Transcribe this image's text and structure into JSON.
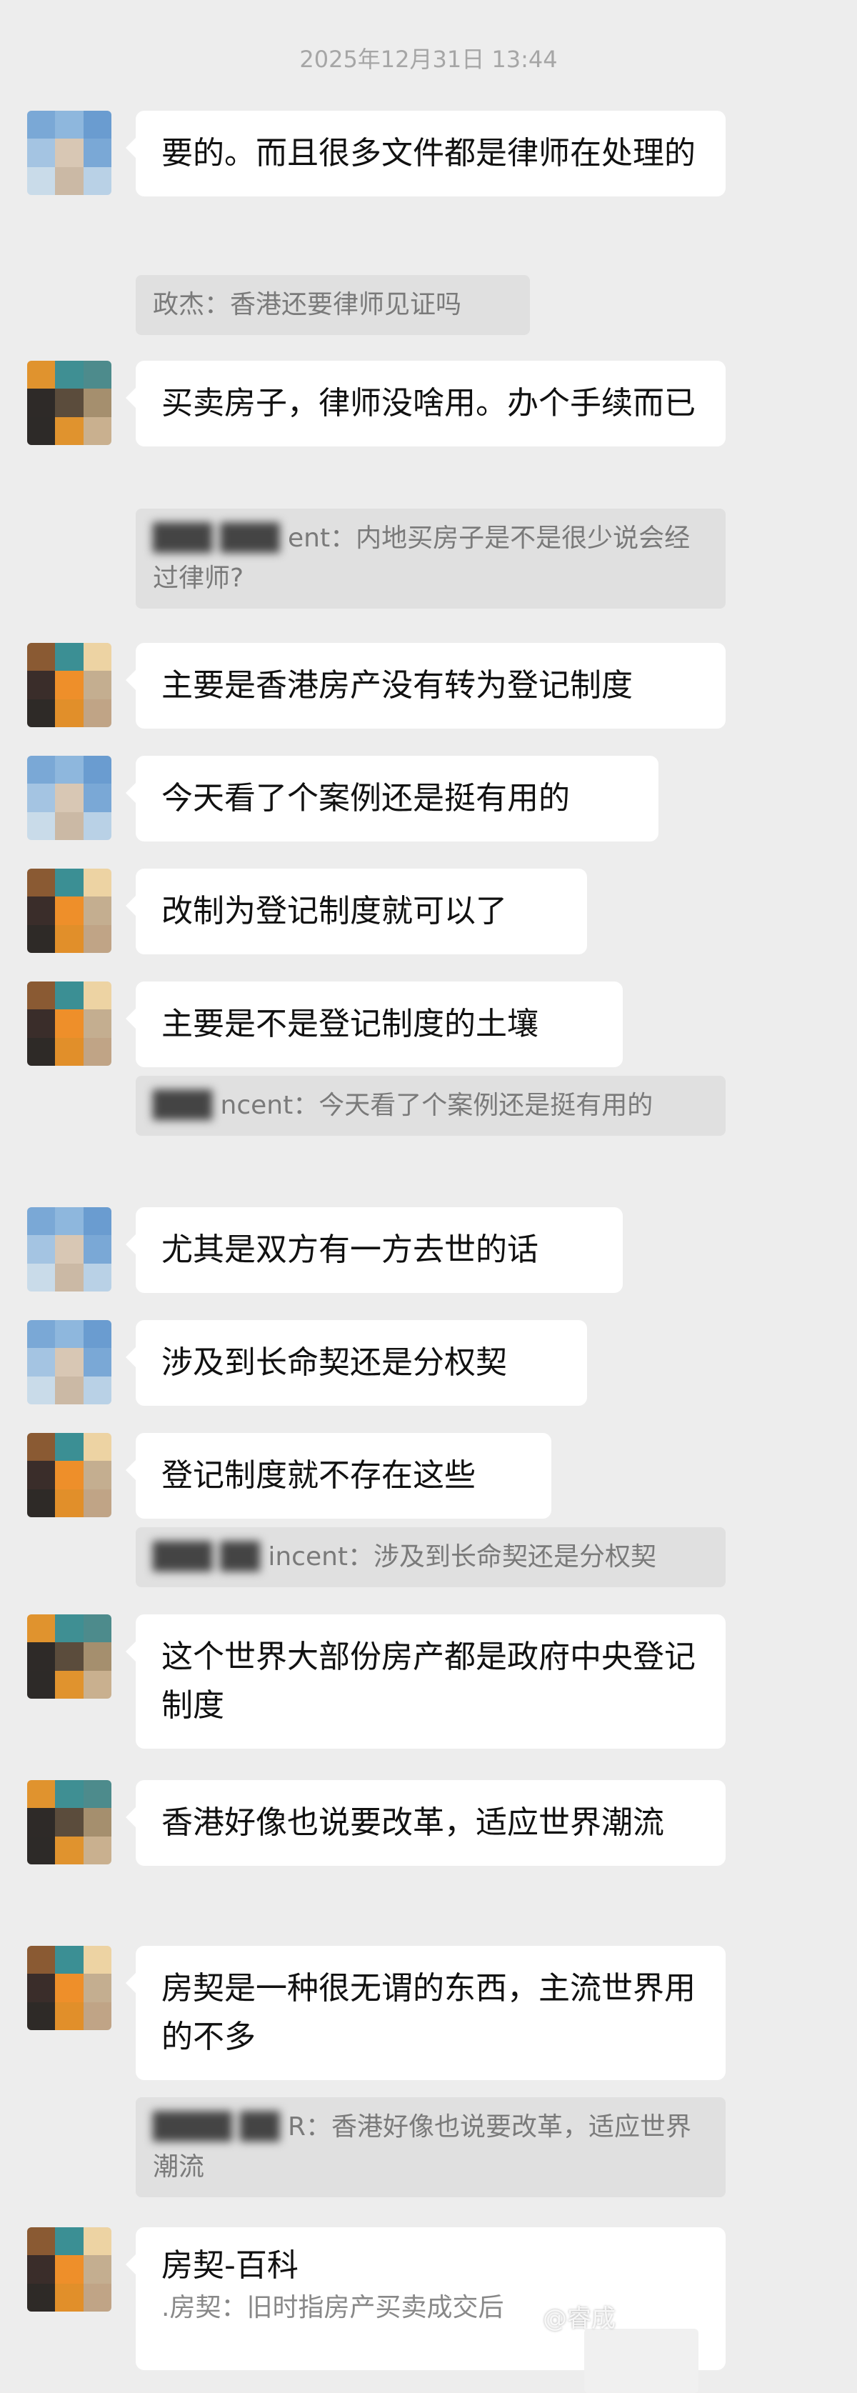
{
  "timestamp": "2025年12月31日 13:44",
  "messages": [
    {
      "text": "要的。而且很多文件都是律师在处理的"
    },
    {
      "quote": "政杰：香港还要律师见证吗"
    },
    {
      "text": "买卖房子，律师没啥用。办个手续而已"
    },
    {
      "quote_name": "ent",
      "quote_text": "：内地买房子是不是很少说会经过律师?"
    },
    {
      "text": "主要是香港房产没有转为登记制度"
    },
    {
      "text": "今天看了个案例还是挺有用的"
    },
    {
      "text": "改制为登记制度就可以了"
    },
    {
      "text": "主要是不是登记制度的土壤"
    },
    {
      "quote_name": "ncent",
      "quote_text": "：今天看了个案例还是挺有用的"
    },
    {
      "text": "尤其是双方有一方去世的话"
    },
    {
      "text": "涉及到长命契还是分权契"
    },
    {
      "text": "登记制度就不存在这些"
    },
    {
      "quote_name": "incent",
      "quote_text": "：涉及到长命契还是分权契"
    },
    {
      "text": "这个世界大部份房产都是政府中央登记制度"
    },
    {
      "text": "香港好像也说要改革，适应世界潮流"
    },
    {
      "text": "房契是一种很无谓的东西，主流世界用的不多"
    },
    {
      "quote_name": "R",
      "quote_text": "：香港好像也说要改革，适应世界潮流"
    }
  ],
  "card": {
    "title": "房契-百科",
    "subtitle": ".房契：旧时指房产买卖成交后"
  },
  "watermark": "@睿成",
  "avatar_colors": {
    "blue": [
      "#7aa8d6",
      "#8eb7dd",
      "#6a9cd0",
      "#a4c4e2",
      "#d8c7b4",
      "#7aa8d6",
      "#c9dbe9",
      "#cbb9a5",
      "#b9d1e6"
    ],
    "orange": [
      "#e0932e",
      "#3f8f93",
      "#4d8b8c",
      "#2e2a28",
      "#5b4c3c",
      "#a58f6e",
      "#2d2a28",
      "#e0932e",
      "#c9b08f"
    ],
    "brown": [
      "#8a5a33",
      "#3b8f94",
      "#edd3a3",
      "#3a2d2a",
      "#ee8f2a",
      "#c4ae90",
      "#2e2a27",
      "#e18f2a",
      "#c0a486"
    ]
  }
}
